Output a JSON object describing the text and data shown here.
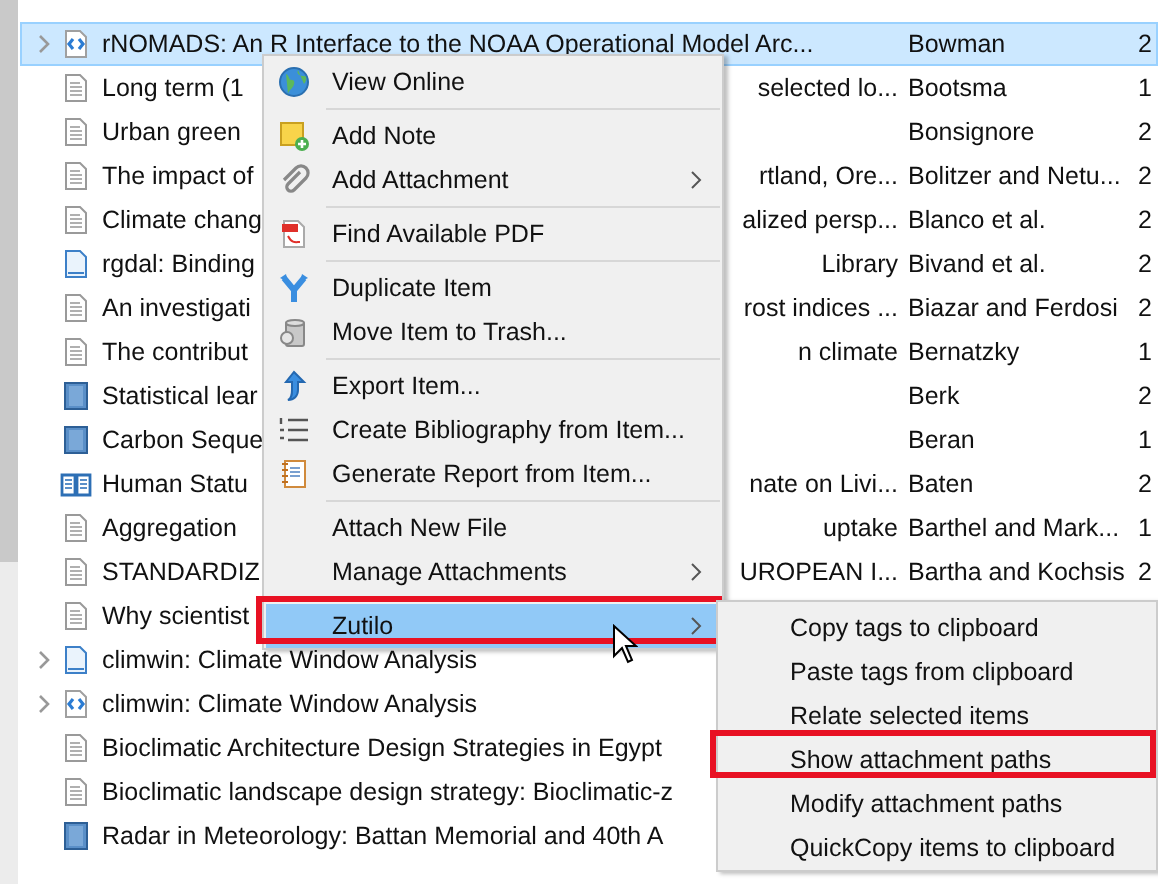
{
  "items_list": {
    "rows": [
      {
        "kind": "software",
        "title": "rNOMADS: An R Interface to the NOAA Operational Model Arc...",
        "creator": "Bowman",
        "column_3": "2",
        "has_children": true,
        "selected": true
      },
      {
        "kind": "document",
        "title": "Long term (1",
        "title_end": "selected lo...",
        "creator": "Bootsma",
        "column_3": "1",
        "has_children": false,
        "selected": false
      },
      {
        "kind": "document",
        "title": "Urban green",
        "creator": "Bonsignore",
        "column_3": "2",
        "has_children": false,
        "selected": false
      },
      {
        "kind": "document",
        "title": "The impact of",
        "title_end": "rtland, Ore...",
        "creator": "Bolitzer and Netu...",
        "column_3": "2",
        "has_children": false,
        "selected": false
      },
      {
        "kind": "document",
        "title": "Climate chang",
        "title_end": "alized persp...",
        "creator": "Blanco et al.",
        "column_3": "2",
        "has_children": false,
        "selected": false
      },
      {
        "kind": "web_page",
        "title": "rgdal: Binding",
        "title_end": "Library",
        "creator": "Bivand et al.",
        "column_3": "2",
        "has_children": false,
        "selected": false
      },
      {
        "kind": "document",
        "title": "An investigati",
        "title_end": "rost indices ...",
        "creator": "Biazar and Ferdosi",
        "column_3": "2",
        "has_children": false,
        "selected": false
      },
      {
        "kind": "document",
        "title": "The contribut",
        "title_end": "n climate",
        "creator": "Bernatzky",
        "column_3": "1",
        "has_children": false,
        "selected": false
      },
      {
        "kind": "book",
        "title": "Statistical lear",
        "creator": "Berk",
        "column_3": "2",
        "has_children": false,
        "selected": false
      },
      {
        "kind": "book",
        "title": "Carbon Seque",
        "creator": "Beran",
        "column_3": "1",
        "has_children": false,
        "selected": false
      },
      {
        "kind": "book_section",
        "title": "Human Statu",
        "title_end": "nate on Livi...",
        "creator": "Baten",
        "column_3": "2",
        "has_children": false,
        "selected": false
      },
      {
        "kind": "document",
        "title": "Aggregation",
        "title_end": "uptake",
        "creator": "Barthel and Mark...",
        "column_3": "1",
        "has_children": false,
        "selected": false
      },
      {
        "kind": "document",
        "title": "STANDARDIZ",
        "title_end": "UROPEAN I...",
        "creator": "Bartha and Kochsis",
        "column_3": "2",
        "has_children": false,
        "selected": false
      },
      {
        "kind": "document",
        "title": "Why scientist",
        "has_children": false,
        "selected": false
      },
      {
        "kind": "web_page",
        "title": "climwin: Climate Window Analysis",
        "has_children": true,
        "selected": false
      },
      {
        "kind": "software",
        "title": "climwin: Climate Window Analysis",
        "has_children": true,
        "selected": false
      },
      {
        "kind": "document",
        "title": "Bioclimatic Architecture Design Strategies in Egypt",
        "has_children": false,
        "selected": false
      },
      {
        "kind": "document",
        "title": "Bioclimatic landscape design strategy: Bioclimatic-z",
        "has_children": false,
        "selected": false
      },
      {
        "kind": "book",
        "title": "Radar in Meteorology: Battan Memorial and 40th A",
        "has_children": false,
        "selected": false
      }
    ]
  },
  "context_menu": {
    "items": [
      {
        "kind": "item",
        "label": "View Online",
        "has_submenu": false,
        "selected": false,
        "annotated": false
      },
      {
        "kind": "separator"
      },
      {
        "kind": "item",
        "label": "Add Note",
        "has_submenu": false,
        "selected": false,
        "annotated": false
      },
      {
        "kind": "item",
        "label": "Add Attachment",
        "has_submenu": true,
        "selected": false,
        "annotated": false
      },
      {
        "kind": "separator"
      },
      {
        "kind": "item",
        "label": "Find Available PDF",
        "has_submenu": false,
        "selected": false,
        "annotated": false
      },
      {
        "kind": "separator"
      },
      {
        "kind": "item",
        "label": "Duplicate Item",
        "has_submenu": false,
        "selected": false,
        "annotated": false
      },
      {
        "kind": "item",
        "label": "Move Item to Trash...",
        "has_submenu": false,
        "selected": false,
        "annotated": false
      },
      {
        "kind": "separator"
      },
      {
        "kind": "item",
        "label": "Export Item...",
        "has_submenu": false,
        "selected": false,
        "annotated": false
      },
      {
        "kind": "item",
        "label": "Create Bibliography from Item...",
        "has_submenu": false,
        "selected": false,
        "annotated": false
      },
      {
        "kind": "item",
        "label": "Generate Report from Item...",
        "has_submenu": false,
        "selected": false,
        "annotated": false
      },
      {
        "kind": "separator"
      },
      {
        "kind": "item",
        "label": "Attach New File",
        "has_submenu": false,
        "selected": false,
        "annotated": false
      },
      {
        "kind": "item",
        "label": "Manage Attachments",
        "has_submenu": true,
        "selected": false,
        "annotated": false
      },
      {
        "kind": "separator"
      },
      {
        "kind": "item",
        "label": "Zutilo",
        "has_submenu": true,
        "selected": true,
        "annotated": true
      }
    ]
  },
  "submenu": {
    "items": [
      {
        "kind": "item",
        "label": "Copy tags to clipboard",
        "has_submenu": false,
        "selected": false,
        "annotated": false
      },
      {
        "kind": "item",
        "label": "Paste tags from clipboard",
        "has_submenu": false,
        "selected": false,
        "annotated": false
      },
      {
        "kind": "item",
        "label": "Relate selected items",
        "has_submenu": false,
        "selected": false,
        "annotated": false
      },
      {
        "kind": "item",
        "label": "Show attachment paths",
        "has_submenu": false,
        "selected": false,
        "annotated": true
      },
      {
        "kind": "item",
        "label": "Modify attachment paths",
        "has_submenu": false,
        "selected": false,
        "annotated": false
      },
      {
        "kind": "item",
        "label": "QuickCopy items to clipboard",
        "has_submenu": false,
        "selected": false,
        "annotated": false
      }
    ]
  }
}
